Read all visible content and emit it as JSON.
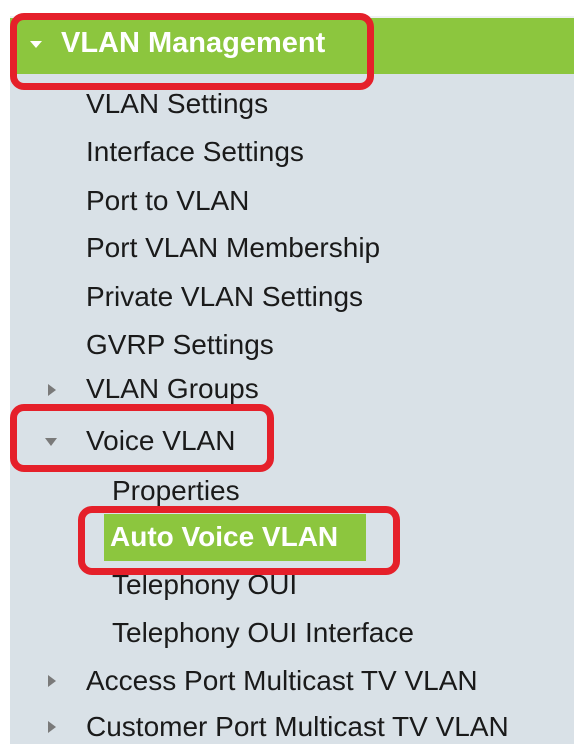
{
  "menu": {
    "header": "VLAN Management",
    "items": [
      "VLAN Settings",
      "Interface Settings",
      "Port to VLAN",
      "Port VLAN Membership",
      "Private VLAN Settings",
      "GVRP Settings",
      "VLAN Groups",
      "Voice VLAN"
    ],
    "voice_vlan_children": [
      "Properties",
      "Auto Voice VLAN",
      "Telephony OUI",
      "Telephony OUI Interface"
    ],
    "bottom_items": [
      "Access Port Multicast TV VLAN",
      "Customer Port Multicast TV VLAN"
    ],
    "selected": "Auto Voice VLAN"
  },
  "colors": {
    "accent_green": "#8cc63e",
    "panel_bg": "#d9e1e7",
    "highlight_red": "#e5202a",
    "text": "#1a1a1a"
  },
  "icons": {
    "expanded": "caret-down-icon",
    "collapsed": "caret-right-icon"
  }
}
